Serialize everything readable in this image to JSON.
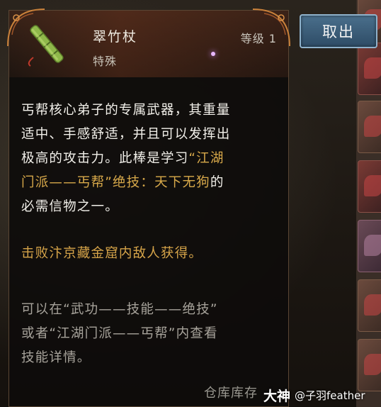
{
  "item": {
    "name": "翠竹杖",
    "rarity": "特殊",
    "level": "等级 1"
  },
  "actions": {
    "take_out_label": "取出"
  },
  "description": {
    "line1": "丐帮核心弟子的专属武器，其重量",
    "line2": "适中、手感舒适，并且可以发挥出",
    "line3_pre": "极高的攻击力。此棒是学习",
    "line3_hl": "“江湖",
    "line4_hl": "门派——丐帮”绝技：天下无狗",
    "line4_post": "的",
    "line5": "必需信物之一。"
  },
  "source": "击败汴京藏金窟内敌人获得。",
  "hint": {
    "line1": "可以在“武功——技能——绝技”",
    "line2": "或者“江湖门派——丐帮”内查看",
    "line3": "技能详情。"
  },
  "background_label": "仓库库存",
  "watermark": {
    "brand": "大神",
    "handle": "@子羽feather"
  },
  "colors": {
    "highlight": "#d8a94a",
    "button": "#3b5d7a"
  },
  "icons": [
    "bamboo-staff-icon"
  ]
}
